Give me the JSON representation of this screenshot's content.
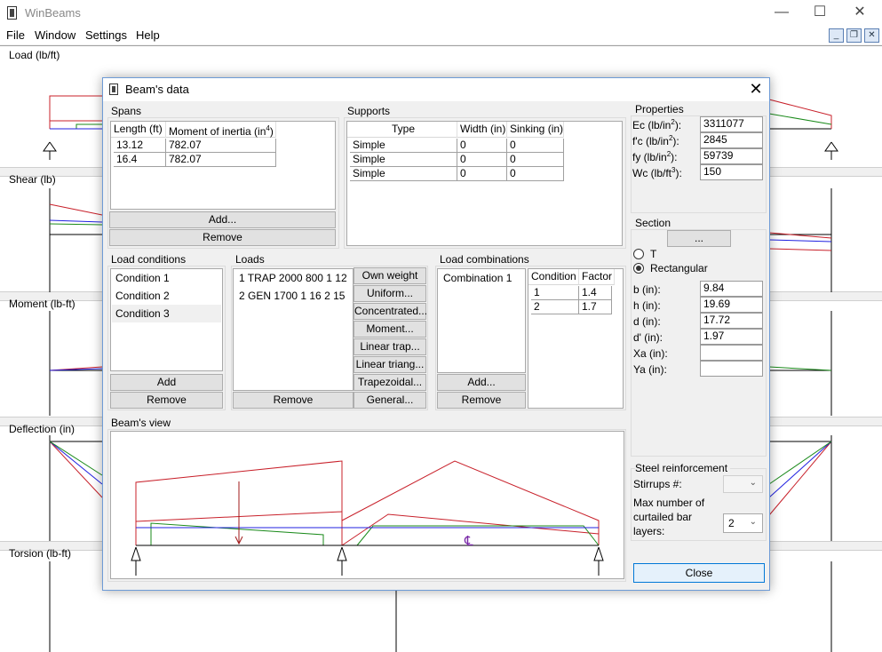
{
  "window": {
    "title": "WinBeams",
    "minimize": "—",
    "maximize": "☐",
    "close": "✕"
  },
  "menu": [
    "File",
    "Window",
    "Settings",
    "Help"
  ],
  "mdi_controls": {
    "minimize": "_",
    "restore": "❐",
    "close": "✕"
  },
  "panes": [
    {
      "label": "Load (lb/ft)"
    },
    {
      "label": "Shear (lb)"
    },
    {
      "label": "Moment (lb-ft)"
    },
    {
      "label": "Deflection (in)"
    },
    {
      "label": "Torsion (lb-ft)"
    }
  ],
  "dialog": {
    "title": "Beam's data",
    "close_glyph": "✕",
    "spans": {
      "label": "Spans",
      "col_length": "Length (ft)",
      "col_inertia": "Moment of inertia (in",
      "col_inertia_sup": "4",
      "col_inertia_close": ")",
      "rows": [
        [
          "13.12",
          "782.07"
        ],
        [
          "16.4",
          "782.07"
        ]
      ],
      "add": "Add...",
      "remove": "Remove"
    },
    "supports": {
      "label": "Supports",
      "col_type": "Type",
      "col_width": "Width (in)",
      "col_sinking": "Sinking (in)",
      "rows": [
        [
          "Simple",
          "0",
          "0"
        ],
        [
          "Simple",
          "0",
          "0"
        ],
        [
          "Simple",
          "0",
          "0"
        ]
      ]
    },
    "properties": {
      "label": "Properties",
      "ec_label": "Ec (lb/in",
      "ec_sup": "2",
      "ec_close": "):",
      "ec": "3311077",
      "fc_label": "f'c (lb/in",
      "fc_sup": "2",
      "fc_close": "):",
      "fc": "2845",
      "fy_label": "fy (lb/in",
      "fy_sup": "2",
      "fy_close": "):",
      "fy": "59739",
      "wc_label": "Wc (lb/ft",
      "wc_sup": "3",
      "wc_close": "):",
      "wc": "150"
    },
    "section": {
      "label": "Section",
      "button": "...",
      "radio_t": "T",
      "radio_rect": "Rectangular",
      "selected": "Rectangular",
      "b_label": "b (in):",
      "b": "9.84",
      "h_label": "h (in):",
      "h": "19.69",
      "d_label": "d (in):",
      "d": "17.72",
      "dp_label": "d' (in):",
      "dp": "1.97",
      "xa_label": "Xa (in):",
      "xa": "",
      "ya_label": "Ya (in):",
      "ya": ""
    },
    "load_conditions": {
      "label": "Load conditions",
      "items": [
        "Condition 1",
        "Condition 2",
        "Condition 3"
      ],
      "add": "Add",
      "remove": "Remove"
    },
    "loads": {
      "label": "Loads",
      "items": [
        "1 TRAP 2000 800 1 12",
        "2 GEN 1700 1 16 2 15"
      ],
      "remove": "Remove",
      "buttons": [
        "Own weight",
        "Uniform...",
        "Concentrated...",
        "Moment...",
        "Linear trap...",
        "Linear triang...",
        "Trapezoidal...",
        "General..."
      ]
    },
    "load_combinations": {
      "label": "Load combinations",
      "items": [
        "Combination 1"
      ],
      "col_condition": "Condition",
      "col_factor": "Factor",
      "rows": [
        [
          "1",
          "1.4"
        ],
        [
          "2",
          "1.7"
        ]
      ],
      "add": "Add...",
      "remove": "Remove"
    },
    "beams_view": {
      "label": "Beam's view",
      "centerline_glyph": "℄"
    },
    "steel": {
      "label": "Steel reinforcement",
      "stirrups_label": "Stirrups #:",
      "stirrups_value": "",
      "max_label_1": "Max number of",
      "max_label_2": "curtailed bar",
      "max_label_3": "layers:",
      "max_value": "2"
    },
    "close_button": "Close"
  },
  "colors": {
    "red": "#c8202a",
    "green": "#1a8a1a",
    "blue": "#2020e0",
    "accent": "#6e9bd6"
  }
}
